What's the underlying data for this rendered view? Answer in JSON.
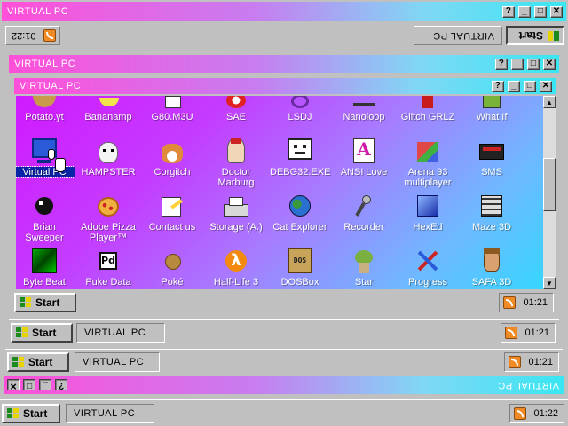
{
  "window_title": "VIRTUAL PC",
  "title_buttons": {
    "help": "?",
    "minimize": "_",
    "maximize": "□",
    "close": "✕"
  },
  "top_taskbar_flipped": {
    "clock": "01:22",
    "task": "VIRTUAL PC",
    "start": "Start"
  },
  "icons_top_row": [
    {
      "label": "Potato.yt"
    },
    {
      "label": "Bananamp"
    },
    {
      "label": "G80.M3U"
    },
    {
      "label": "SAE"
    },
    {
      "label": "LSDJ"
    },
    {
      "label": "Nanoloop"
    },
    {
      "label": "Glitch GRLZ"
    },
    {
      "label": "What If"
    }
  ],
  "icons_row2": [
    {
      "label": "Virtual PC"
    },
    {
      "label": "HAMPSTER"
    },
    {
      "label": "Corgitch"
    },
    {
      "label": "Doctor Marburg"
    },
    {
      "label": "DEBG32.EXE"
    },
    {
      "label": "ANSI Love"
    },
    {
      "label": "Arena 93 multiplayer"
    },
    {
      "label": "SMS"
    }
  ],
  "icons_row3": [
    {
      "label": "Brian Sweeper"
    },
    {
      "label": "Adobe Pizza Player™"
    },
    {
      "label": "Contact us"
    },
    {
      "label": "Storage (A:)"
    },
    {
      "label": "Cat Explorer"
    },
    {
      "label": "Recorder"
    },
    {
      "label": "HexEd"
    },
    {
      "label": "Maze 3D"
    }
  ],
  "icons_row4": [
    {
      "label": "Byte Beat"
    },
    {
      "label": "Puke Data"
    },
    {
      "label": "Poké"
    },
    {
      "label": "Half-Life 3"
    },
    {
      "label": "DOSBox"
    },
    {
      "label": "Star"
    },
    {
      "label": "Progress"
    },
    {
      "label": "SAFA 3D"
    }
  ],
  "icon_glyphs": {
    "puke": "Pd",
    "dos": "DOS",
    "ansi": "A",
    "halflife": "λ"
  },
  "inner_taskbar": {
    "start": "Start",
    "clock": "01:21"
  },
  "taskbar2": {
    "start": "Start",
    "task": "VIRTUAL PC",
    "clock": "01:21"
  },
  "taskbar3": {
    "start": "Start",
    "task": "VIRTUAL PC",
    "clock": "01:21"
  },
  "bottom_taskbar": {
    "start": "Start",
    "task": "VIRTUAL PC",
    "clock": "01:22"
  },
  "flipped_title": "VIRTUAL PC",
  "colors": {
    "accent_pink": "#ff4fd8",
    "accent_cyan": "#39e6f2",
    "face": "#c0c0c0",
    "selection": "#0a24a8"
  }
}
